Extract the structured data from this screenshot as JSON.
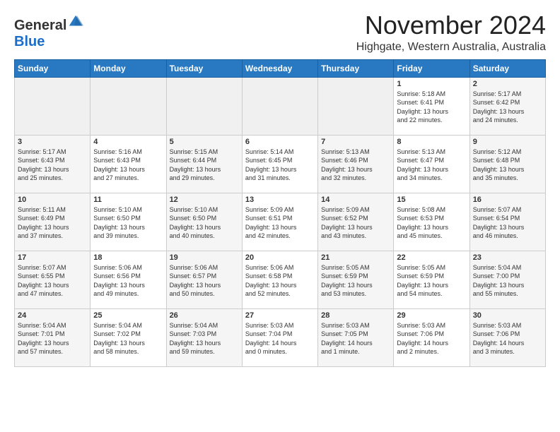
{
  "header": {
    "logo_general": "General",
    "logo_blue": "Blue",
    "title": "November 2024",
    "location": "Highgate, Western Australia, Australia"
  },
  "days_of_week": [
    "Sunday",
    "Monday",
    "Tuesday",
    "Wednesday",
    "Thursday",
    "Friday",
    "Saturday"
  ],
  "weeks": [
    [
      {
        "day": "",
        "info": ""
      },
      {
        "day": "",
        "info": ""
      },
      {
        "day": "",
        "info": ""
      },
      {
        "day": "",
        "info": ""
      },
      {
        "day": "",
        "info": ""
      },
      {
        "day": "1",
        "info": "Sunrise: 5:18 AM\nSunset: 6:41 PM\nDaylight: 13 hours\nand 22 minutes."
      },
      {
        "day": "2",
        "info": "Sunrise: 5:17 AM\nSunset: 6:42 PM\nDaylight: 13 hours\nand 24 minutes."
      }
    ],
    [
      {
        "day": "3",
        "info": "Sunrise: 5:17 AM\nSunset: 6:43 PM\nDaylight: 13 hours\nand 25 minutes."
      },
      {
        "day": "4",
        "info": "Sunrise: 5:16 AM\nSunset: 6:43 PM\nDaylight: 13 hours\nand 27 minutes."
      },
      {
        "day": "5",
        "info": "Sunrise: 5:15 AM\nSunset: 6:44 PM\nDaylight: 13 hours\nand 29 minutes."
      },
      {
        "day": "6",
        "info": "Sunrise: 5:14 AM\nSunset: 6:45 PM\nDaylight: 13 hours\nand 31 minutes."
      },
      {
        "day": "7",
        "info": "Sunrise: 5:13 AM\nSunset: 6:46 PM\nDaylight: 13 hours\nand 32 minutes."
      },
      {
        "day": "8",
        "info": "Sunrise: 5:13 AM\nSunset: 6:47 PM\nDaylight: 13 hours\nand 34 minutes."
      },
      {
        "day": "9",
        "info": "Sunrise: 5:12 AM\nSunset: 6:48 PM\nDaylight: 13 hours\nand 35 minutes."
      }
    ],
    [
      {
        "day": "10",
        "info": "Sunrise: 5:11 AM\nSunset: 6:49 PM\nDaylight: 13 hours\nand 37 minutes."
      },
      {
        "day": "11",
        "info": "Sunrise: 5:10 AM\nSunset: 6:50 PM\nDaylight: 13 hours\nand 39 minutes."
      },
      {
        "day": "12",
        "info": "Sunrise: 5:10 AM\nSunset: 6:50 PM\nDaylight: 13 hours\nand 40 minutes."
      },
      {
        "day": "13",
        "info": "Sunrise: 5:09 AM\nSunset: 6:51 PM\nDaylight: 13 hours\nand 42 minutes."
      },
      {
        "day": "14",
        "info": "Sunrise: 5:09 AM\nSunset: 6:52 PM\nDaylight: 13 hours\nand 43 minutes."
      },
      {
        "day": "15",
        "info": "Sunrise: 5:08 AM\nSunset: 6:53 PM\nDaylight: 13 hours\nand 45 minutes."
      },
      {
        "day": "16",
        "info": "Sunrise: 5:07 AM\nSunset: 6:54 PM\nDaylight: 13 hours\nand 46 minutes."
      }
    ],
    [
      {
        "day": "17",
        "info": "Sunrise: 5:07 AM\nSunset: 6:55 PM\nDaylight: 13 hours\nand 47 minutes."
      },
      {
        "day": "18",
        "info": "Sunrise: 5:06 AM\nSunset: 6:56 PM\nDaylight: 13 hours\nand 49 minutes."
      },
      {
        "day": "19",
        "info": "Sunrise: 5:06 AM\nSunset: 6:57 PM\nDaylight: 13 hours\nand 50 minutes."
      },
      {
        "day": "20",
        "info": "Sunrise: 5:06 AM\nSunset: 6:58 PM\nDaylight: 13 hours\nand 52 minutes."
      },
      {
        "day": "21",
        "info": "Sunrise: 5:05 AM\nSunset: 6:59 PM\nDaylight: 13 hours\nand 53 minutes."
      },
      {
        "day": "22",
        "info": "Sunrise: 5:05 AM\nSunset: 6:59 PM\nDaylight: 13 hours\nand 54 minutes."
      },
      {
        "day": "23",
        "info": "Sunrise: 5:04 AM\nSunset: 7:00 PM\nDaylight: 13 hours\nand 55 minutes."
      }
    ],
    [
      {
        "day": "24",
        "info": "Sunrise: 5:04 AM\nSunset: 7:01 PM\nDaylight: 13 hours\nand 57 minutes."
      },
      {
        "day": "25",
        "info": "Sunrise: 5:04 AM\nSunset: 7:02 PM\nDaylight: 13 hours\nand 58 minutes."
      },
      {
        "day": "26",
        "info": "Sunrise: 5:04 AM\nSunset: 7:03 PM\nDaylight: 13 hours\nand 59 minutes."
      },
      {
        "day": "27",
        "info": "Sunrise: 5:03 AM\nSunset: 7:04 PM\nDaylight: 14 hours\nand 0 minutes."
      },
      {
        "day": "28",
        "info": "Sunrise: 5:03 AM\nSunset: 7:05 PM\nDaylight: 14 hours\nand 1 minute."
      },
      {
        "day": "29",
        "info": "Sunrise: 5:03 AM\nSunset: 7:06 PM\nDaylight: 14 hours\nand 2 minutes."
      },
      {
        "day": "30",
        "info": "Sunrise: 5:03 AM\nSunset: 7:06 PM\nDaylight: 14 hours\nand 3 minutes."
      }
    ]
  ]
}
